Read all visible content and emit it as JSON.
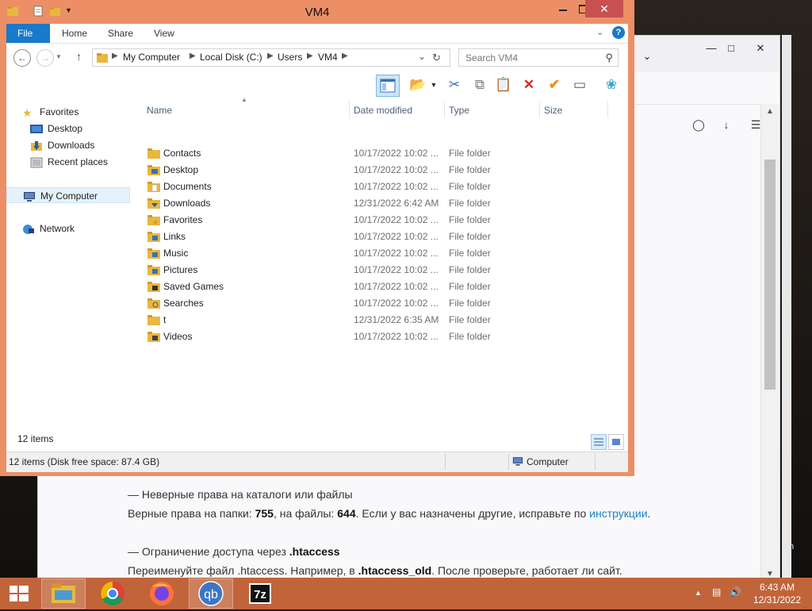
{
  "desktop": {
    "recycle_bin_label": "e Bin"
  },
  "browser": {
    "content": {
      "line1": "— Неверные права на каталоги или файлы",
      "line2_pre": "Верные права на папки: ",
      "line2_b1": "755",
      "line2_mid": ", на файлы: ",
      "line2_b2": "644",
      "line2_post": ". Если у вас назначены другие, исправьте по ",
      "line2_link": "инструкции",
      "line2_end": ".",
      "line3_pre": "— Ограничение доступа через ",
      "line3_b": ".htaccess",
      "line4_pre": "Переименуйте файл .htaccess. Например, в ",
      "line4_b": ".htaccess_old",
      "line4_post": ". После проверьте, работает ли сайт."
    }
  },
  "explorer": {
    "title": "VM4",
    "ribbon_tabs": [
      "File",
      "Home",
      "Share",
      "View"
    ],
    "breadcrumbs": [
      "My Computer",
      "Local Disk (C:)",
      "Users",
      "VM4"
    ],
    "search_placeholder": "Search VM4",
    "nav": {
      "favorites": "Favorites",
      "desktop": "Desktop",
      "downloads": "Downloads",
      "recent": "Recent places",
      "mycomputer": "My Computer",
      "network": "Network"
    },
    "columns": {
      "name": "Name",
      "date": "Date modified",
      "type": "Type",
      "size": "Size"
    },
    "files": [
      {
        "name": "Contacts",
        "date": "10/17/2022 10:02 ...",
        "type": "File folder"
      },
      {
        "name": "Desktop",
        "date": "10/17/2022 10:02 ...",
        "type": "File folder"
      },
      {
        "name": "Documents",
        "date": "10/17/2022 10:02 ...",
        "type": "File folder"
      },
      {
        "name": "Downloads",
        "date": "12/31/2022 6:42 AM",
        "type": "File folder"
      },
      {
        "name": "Favorites",
        "date": "10/17/2022 10:02 ...",
        "type": "File folder"
      },
      {
        "name": "Links",
        "date": "10/17/2022 10:02 ...",
        "type": "File folder"
      },
      {
        "name": "Music",
        "date": "10/17/2022 10:02 ...",
        "type": "File folder"
      },
      {
        "name": "Pictures",
        "date": "10/17/2022 10:02 ...",
        "type": "File folder"
      },
      {
        "name": "Saved Games",
        "date": "10/17/2022 10:02 ...",
        "type": "File folder"
      },
      {
        "name": "Searches",
        "date": "10/17/2022 10:02 ...",
        "type": "File folder"
      },
      {
        "name": "t",
        "date": "12/31/2022 6:35 AM",
        "type": "File folder"
      },
      {
        "name": "Videos",
        "date": "10/17/2022 10:02 ...",
        "type": "File folder"
      }
    ],
    "item_count": "12 items",
    "status_left": "12 items (Disk free space: 87.4 GB)",
    "status_right": "Computer"
  },
  "taskbar": {
    "apps": [
      "start-button",
      "file-explorer",
      "chrome",
      "firefox",
      "qbittorrent",
      "7zip"
    ],
    "qb_label": "qb",
    "sevenzip_label": "7z",
    "clock_time": "6:43 AM",
    "clock_date": "12/31/2022"
  },
  "colors": {
    "window_frame": "#ec8f66",
    "taskbar": "#c1643a",
    "file_tab": "#1979ca",
    "close_button": "#c75050",
    "link": "#1e7fc1"
  }
}
